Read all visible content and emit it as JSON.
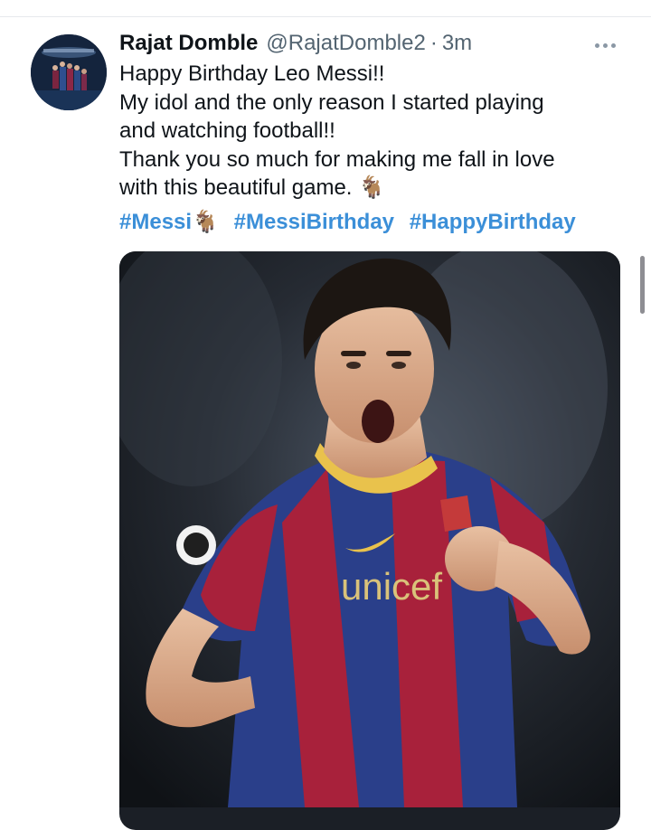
{
  "tweet": {
    "author_name": "Rajat Domble",
    "author_handle": "@RajatDomble2",
    "separator": "·",
    "timestamp": "3m",
    "text_lines": [
      "Happy Birthday Leo Messi!!",
      "My idol and the only reason I started playing",
      "and watching football!!",
      "Thank you so much for making me fall in love",
      "with this beautiful game. 🐐"
    ],
    "hashtags": [
      "#Messi🐐",
      "#MessiBirthday",
      "#HappyBirthday"
    ],
    "media": {
      "jersey_sponsor": "unicef"
    }
  },
  "icons": {
    "more": "more-horizontal-icon",
    "avatar": "avatar"
  },
  "colors": {
    "hashtag": "#3b8fd8",
    "secondary_text": "#536471",
    "divider": "#e6e9ec"
  }
}
